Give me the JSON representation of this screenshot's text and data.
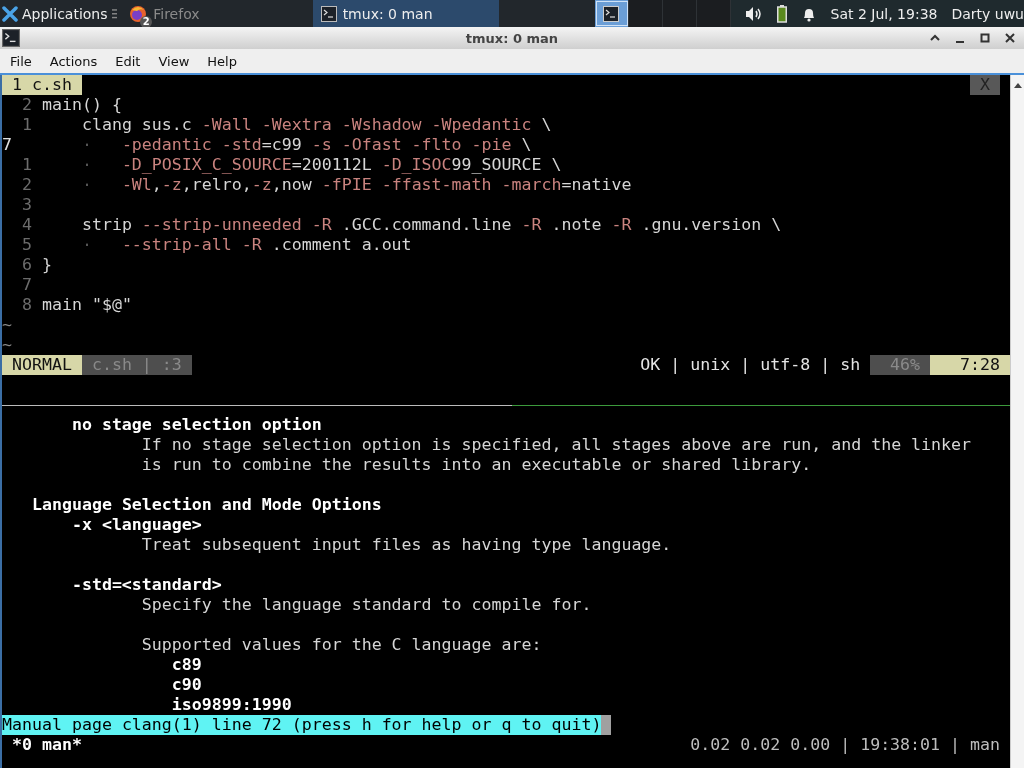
{
  "panel": {
    "apps_label": "Applications",
    "tasks": [
      {
        "kind": "browser",
        "label": "Firefox",
        "badge": "2",
        "selected": false
      },
      {
        "kind": "terminal",
        "label": "tmux: 0 man",
        "selected": true
      }
    ],
    "workspaces": [
      {
        "selected": true
      },
      {
        "selected": false
      },
      {
        "selected": false
      },
      {
        "selected": false
      }
    ],
    "clock": "Sat  2 Jul, 19:38",
    "user": "Darty uwu"
  },
  "window": {
    "title": "tmux: 0 man"
  },
  "menu": [
    "File",
    "Actions",
    "Edit",
    "View",
    "Help"
  ],
  "vim": {
    "tab": {
      "label": "1 c.sh",
      "selected": true
    },
    "close": "X",
    "lines": [
      {
        "number": "2",
        "current": false,
        "tokens": [
          {
            "text": "main() {",
            "kind": "plain"
          }
        ]
      },
      {
        "number": "1",
        "current": false,
        "tokens": [
          {
            "text": "    clang sus.c ",
            "kind": "plain"
          },
          {
            "text": "-Wall -Wextra -Wshadow -Wpedantic",
            "kind": "flag"
          },
          {
            "text": " \\",
            "kind": "plain"
          }
        ]
      },
      {
        "number": "7",
        "current": true,
        "tokens": [
          {
            "text": "·",
            "kind": "guide"
          },
          {
            "text": "-pedantic -std",
            "kind": "flag"
          },
          {
            "text": "=c99 ",
            "kind": "plain"
          },
          {
            "text": "-s -Ofast -flto -pie",
            "kind": "flag"
          },
          {
            "text": " \\",
            "kind": "plain"
          }
        ]
      },
      {
        "number": "1",
        "current": false,
        "tokens": [
          {
            "text": "·",
            "kind": "guide"
          },
          {
            "text": "-D_POSIX_C_SOURCE",
            "kind": "flag"
          },
          {
            "text": "=200112L ",
            "kind": "plain"
          },
          {
            "text": "-D_ISOC",
            "kind": "flag"
          },
          {
            "text": "99_SOURCE \\",
            "kind": "plain"
          }
        ]
      },
      {
        "number": "2",
        "current": false,
        "tokens": [
          {
            "text": "·",
            "kind": "guide"
          },
          {
            "text": "-Wl",
            "kind": "flag"
          },
          {
            "text": ",",
            "kind": "plain"
          },
          {
            "text": "-z",
            "kind": "flag"
          },
          {
            "text": ",relro,",
            "kind": "plain"
          },
          {
            "text": "-z",
            "kind": "flag"
          },
          {
            "text": ",now ",
            "kind": "plain"
          },
          {
            "text": "-fPIE -ffast-math -march",
            "kind": "flag"
          },
          {
            "text": "=native",
            "kind": "plain"
          }
        ]
      },
      {
        "number": "3",
        "current": false
      },
      {
        "number": "4",
        "current": false,
        "tokens": [
          {
            "text": "    strip ",
            "kind": "plain"
          },
          {
            "text": "--strip-unneeded -R",
            "kind": "flag"
          },
          {
            "text": " .GCC.command.line ",
            "kind": "plain"
          },
          {
            "text": "-R",
            "kind": "flag"
          },
          {
            "text": " .note ",
            "kind": "plain"
          },
          {
            "text": "-R",
            "kind": "flag"
          },
          {
            "text": " .gnu.version \\",
            "kind": "plain"
          }
        ]
      },
      {
        "number": "5",
        "current": false,
        "tokens": [
          {
            "text": "·",
            "kind": "guide"
          },
          {
            "text": "--strip-all -R",
            "kind": "flag"
          },
          {
            "text": " .comment a.out",
            "kind": "plain"
          }
        ]
      },
      {
        "number": "6",
        "current": false,
        "tokens": [
          {
            "text": "}",
            "kind": "plain"
          }
        ]
      },
      {
        "number": "7",
        "current": false
      },
      {
        "number": "8",
        "current": false,
        "tokens": [
          {
            "text": "main \"$@\"",
            "kind": "plain"
          }
        ]
      }
    ],
    "filler": [
      "~",
      "~"
    ],
    "status": {
      "mode": "NORMAL",
      "file": "c.sh | :3",
      "info": "OK | unix | utf-8 | sh",
      "percent": "46%",
      "position": "7:28"
    }
  },
  "man": {
    "paragraphs": [
      {
        "lines": [
          {
            "kind": "option",
            "text": "no stage selection option"
          },
          {
            "kind": "desc",
            "text": "If no stage selection option is specified, all stages above are run, and the linker"
          },
          {
            "kind": "desc",
            "text": "is run to combine the results into an executable or shared library."
          }
        ]
      },
      {
        "lines": [
          {
            "kind": "section",
            "text": "Language Selection and Mode Options"
          },
          {
            "kind": "option",
            "text": "-x <language>"
          },
          {
            "kind": "desc",
            "text": "Treat subsequent input files as having type language."
          }
        ]
      },
      {
        "lines": [
          {
            "kind": "option",
            "text": "-std=<standard>"
          },
          {
            "kind": "desc",
            "text": "Specify the language standard to compile for."
          }
        ]
      },
      {
        "lines": [
          {
            "kind": "desc",
            "text": "Supported values for the C language are:"
          },
          {
            "kind": "value",
            "text": "c89"
          },
          {
            "kind": "value",
            "text": "c90"
          },
          {
            "kind": "value",
            "text": "iso9899:1990"
          }
        ]
      }
    ],
    "prompt": "Manual page clang(1) line 72 (press h for help or q to quit)"
  },
  "tmux": {
    "window": "*0 man*",
    "right": "0.02 0.02 0.00 | 19:38:01 | man"
  }
}
